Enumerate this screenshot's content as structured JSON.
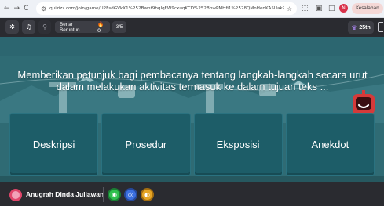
{
  "browser": {
    "nav_back": "←",
    "nav_forward": "→",
    "nav_reload": "C",
    "url": "quizizz.com/join/game/U2FsdGVkX1%252Bwnt9bqIqFW9cxuqKCD%252BbwPMHfi1%2528QMnHenKA5Uak9OgsHHnmVWAGN...",
    "extensions": [
      "☆",
      "⬚",
      "▣",
      "□"
    ],
    "profile_initial": "N",
    "profile_label": "Kesalahan"
  },
  "topbar": {
    "settings_icon": "✲",
    "music_icon": "♫",
    "search_icon": "⚲",
    "status_label": "Benar Beruntun",
    "streak_value": "🔥0",
    "progress": "3/5",
    "rank": "25th"
  },
  "question": {
    "text": "Memberikan petunjuk bagi pembacanya tentang langkah-langkah secara urut dalam melakukan aktivitas termasuk ke dalam tujuan teks ..."
  },
  "options": [
    {
      "label": "Deskripsi"
    },
    {
      "label": "Prosedur"
    },
    {
      "label": "Eksposisi"
    },
    {
      "label": "Anekdot"
    }
  ],
  "player": {
    "name": "Anugrah Dinda Juliawan"
  },
  "powerups": [
    {
      "name": "streak-saver",
      "color": "#2fbf4e",
      "glyph": "◉"
    },
    {
      "name": "double-jeopardy",
      "color": "#3b6fe0",
      "glyph": "◎"
    },
    {
      "name": "power-play",
      "color": "#e6a525",
      "glyph": "◐"
    }
  ],
  "colors": {
    "stage": "#2f6b74",
    "option": "#1d5d68",
    "bar": "#2a2b30",
    "accent_purple": "#b48cff"
  }
}
